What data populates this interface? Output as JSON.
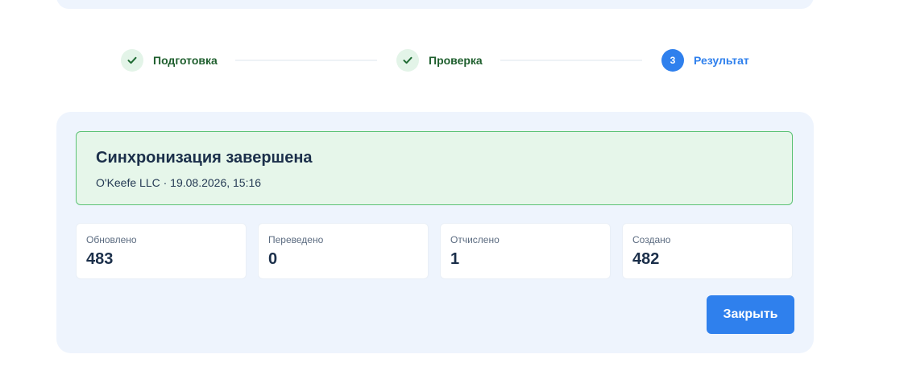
{
  "stepper": {
    "steps": [
      {
        "label": "Подготовка",
        "state": "done",
        "icon": "check-icon"
      },
      {
        "label": "Проверка",
        "state": "done",
        "icon": "check-icon"
      },
      {
        "label": "Результат",
        "state": "active",
        "number": "3"
      }
    ]
  },
  "result": {
    "title": "Синхронизация завершена",
    "subtitle": "O'Keefe LLC · 19.08.2026, 15:16"
  },
  "stats": [
    {
      "label": "Обновлено",
      "value": "483"
    },
    {
      "label": "Переведено",
      "value": "0"
    },
    {
      "label": "Отчислено",
      "value": "1"
    },
    {
      "label": "Создано",
      "value": "482"
    }
  ],
  "actions": {
    "close_label": "Закрыть"
  },
  "colors": {
    "accent": "#2f80ed",
    "success_bg": "#e6f6ea",
    "success_border": "#5cc275",
    "card_bg": "#eef4fd",
    "done_text": "#1f5f2e"
  }
}
